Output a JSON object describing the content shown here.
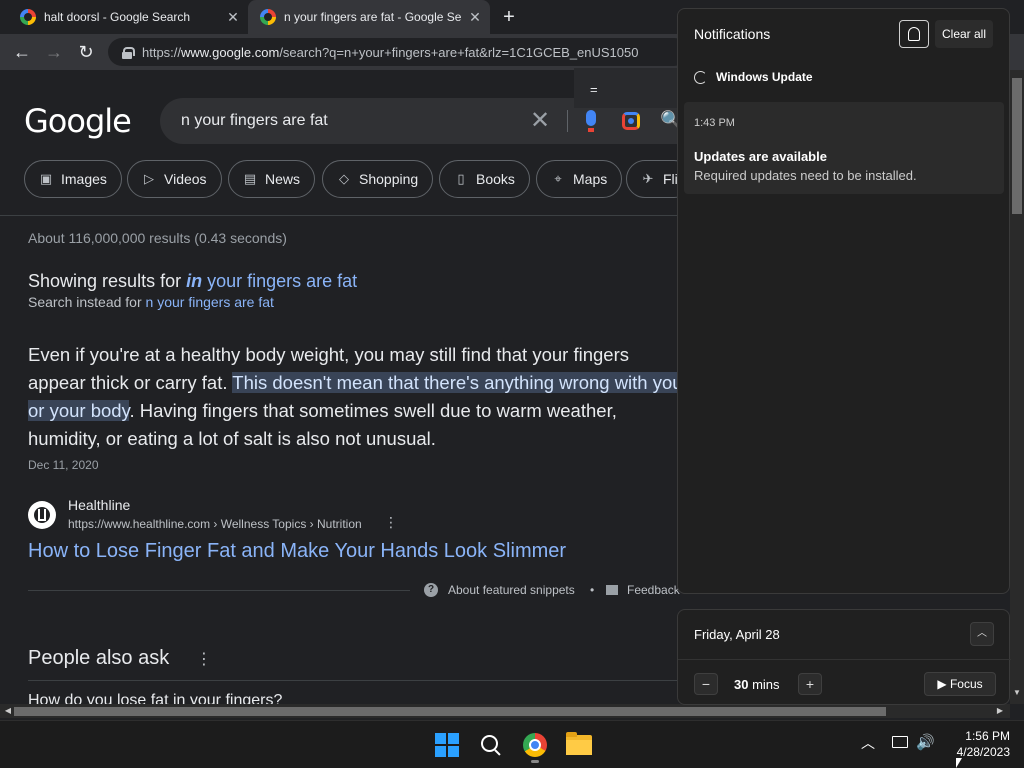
{
  "browser": {
    "tabs": [
      {
        "title": "halt doorsl - Google Search"
      },
      {
        "title": "n your fingers are fat - Google Se"
      }
    ],
    "url_prefix": "https://",
    "url_domain": "www.google.com",
    "url_path": "/search?q=n+your+fingers+are+fat&rlz=1C1GCEB_enUS1050",
    "popup_text": "="
  },
  "google": {
    "logo": "Google",
    "query": "n your fingers are fat",
    "chips": [
      "Images",
      "Videos",
      "News",
      "Shopping",
      "Books",
      "Maps",
      "Fli"
    ],
    "stats": "About 116,000,000 results (0.43 seconds)",
    "showing_prefix": "Showing results for ",
    "showing_corr_bold": "in",
    "showing_corr_rest": " your fingers are fat",
    "instead_prefix": "Search instead for ",
    "instead_link": "n your fingers are fat",
    "snippet_a": "Even if you're at a healthy body weight, you may still find that your fingers appear thick or carry fat. ",
    "snippet_hl": "This doesn't mean that there's anything wrong with you or your body",
    "snippet_b": ". Having fingers that sometimes swell due to warm weather, humidity, or eating a lot of salt is also not unusual.",
    "snippet_date": "Dec 11, 2020",
    "source_name": "Healthline",
    "source_url": "https://www.healthline.com › Wellness Topics › Nutrition",
    "result_title": "How to Lose Finger Fat and Make Your Hands Look Slimmer",
    "about_snippets": "About featured snippets",
    "dot": "•",
    "feedback": "Feedback",
    "paa_title": "People also ask",
    "paa_question": "How do you lose fat in your fingers?"
  },
  "notifications": {
    "title": "Notifications",
    "clear_all": "Clear all",
    "app": "Windows Update",
    "time": "1:43 PM",
    "heading": "Updates are available",
    "body": "Required updates need to be installed."
  },
  "calendar": {
    "date": "Friday, April 28",
    "minutes": "30",
    "minutes_unit": " mins",
    "focus": "Focus"
  },
  "taskbar": {
    "time": "1:56 PM",
    "date": "4/28/2023"
  }
}
